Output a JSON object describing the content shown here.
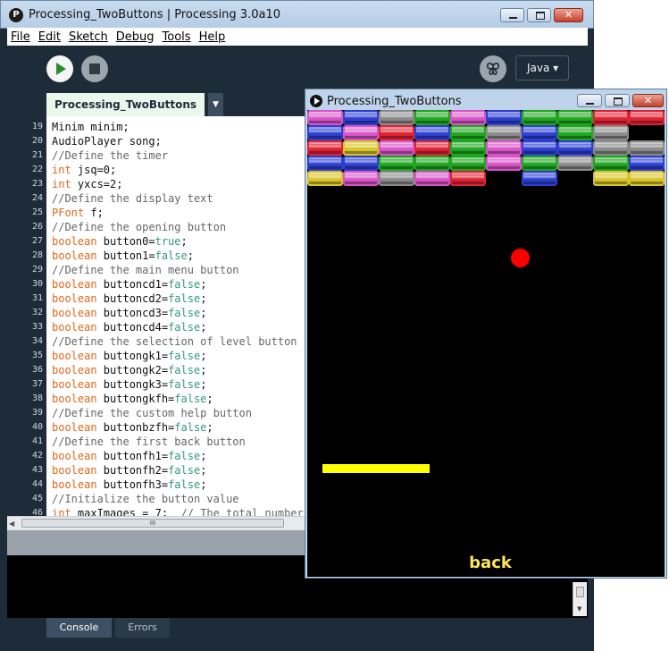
{
  "ide": {
    "title": "Processing_TwoButtons | Processing 3.0a10",
    "logo_glyph": "P",
    "menu": [
      "File",
      "Edit",
      "Sketch",
      "Debug",
      "Tools",
      "Help"
    ],
    "mode": "Java ▾",
    "tab": "Processing_TwoButtons",
    "tab_menu_glyph": "▼",
    "code": [
      {
        "n": "19",
        "parts": [
          {
            "t": "Minim minim;",
            "c": ""
          }
        ]
      },
      {
        "n": "20",
        "parts": [
          {
            "t": "AudioPlayer song;",
            "c": ""
          }
        ]
      },
      {
        "n": "21",
        "parts": [
          {
            "t": "//Define the timer",
            "c": "cm"
          }
        ]
      },
      {
        "n": "22",
        "parts": [
          {
            "t": "int",
            "c": "kw"
          },
          {
            "t": " jsq=0;",
            "c": ""
          }
        ]
      },
      {
        "n": "23",
        "parts": [
          {
            "t": "int",
            "c": "kw"
          },
          {
            "t": " yxcs=2;",
            "c": ""
          }
        ]
      },
      {
        "n": "24",
        "parts": [
          {
            "t": "//Define the display text",
            "c": "cm"
          }
        ]
      },
      {
        "n": "25",
        "parts": [
          {
            "t": "PFont",
            "c": "kw"
          },
          {
            "t": " f;",
            "c": ""
          }
        ]
      },
      {
        "n": "26",
        "parts": [
          {
            "t": "//Define the opening button",
            "c": "cm"
          }
        ]
      },
      {
        "n": "27",
        "parts": [
          {
            "t": "boolean",
            "c": "kw"
          },
          {
            "t": " button0=",
            "c": ""
          },
          {
            "t": "true",
            "c": "lit"
          },
          {
            "t": ";",
            "c": ""
          }
        ]
      },
      {
        "n": "28",
        "parts": [
          {
            "t": "boolean",
            "c": "kw"
          },
          {
            "t": " button1=",
            "c": ""
          },
          {
            "t": "false",
            "c": "lit"
          },
          {
            "t": ";",
            "c": ""
          }
        ]
      },
      {
        "n": "29",
        "parts": [
          {
            "t": "//Define the main menu button",
            "c": "cm"
          }
        ]
      },
      {
        "n": "30",
        "parts": [
          {
            "t": "boolean",
            "c": "kw"
          },
          {
            "t": " buttoncd1=",
            "c": ""
          },
          {
            "t": "false",
            "c": "lit"
          },
          {
            "t": ";",
            "c": ""
          }
        ]
      },
      {
        "n": "31",
        "parts": [
          {
            "t": "boolean",
            "c": "kw"
          },
          {
            "t": " buttoncd2=",
            "c": ""
          },
          {
            "t": "false",
            "c": "lit"
          },
          {
            "t": ";",
            "c": ""
          }
        ]
      },
      {
        "n": "32",
        "parts": [
          {
            "t": "boolean",
            "c": "kw"
          },
          {
            "t": " buttoncd3=",
            "c": ""
          },
          {
            "t": "false",
            "c": "lit"
          },
          {
            "t": ";",
            "c": ""
          }
        ]
      },
      {
        "n": "33",
        "parts": [
          {
            "t": "boolean",
            "c": "kw"
          },
          {
            "t": " buttoncd4=",
            "c": ""
          },
          {
            "t": "false",
            "c": "lit"
          },
          {
            "t": ";",
            "c": ""
          }
        ]
      },
      {
        "n": "34",
        "parts": [
          {
            "t": "//Define the selection of level button",
            "c": "cm"
          }
        ]
      },
      {
        "n": "35",
        "parts": [
          {
            "t": "boolean",
            "c": "kw"
          },
          {
            "t": " buttongk1=",
            "c": ""
          },
          {
            "t": "false",
            "c": "lit"
          },
          {
            "t": ";",
            "c": ""
          }
        ]
      },
      {
        "n": "36",
        "parts": [
          {
            "t": "boolean",
            "c": "kw"
          },
          {
            "t": " buttongk2=",
            "c": ""
          },
          {
            "t": "false",
            "c": "lit"
          },
          {
            "t": ";",
            "c": ""
          }
        ]
      },
      {
        "n": "37",
        "parts": [
          {
            "t": "boolean",
            "c": "kw"
          },
          {
            "t": " buttongk3=",
            "c": ""
          },
          {
            "t": "false",
            "c": "lit"
          },
          {
            "t": ";",
            "c": ""
          }
        ]
      },
      {
        "n": "38",
        "parts": [
          {
            "t": "boolean",
            "c": "kw"
          },
          {
            "t": " buttongkfh=",
            "c": ""
          },
          {
            "t": "false",
            "c": "lit"
          },
          {
            "t": ";",
            "c": ""
          }
        ]
      },
      {
        "n": "39",
        "parts": [
          {
            "t": "//Define the custom help button",
            "c": "cm"
          }
        ]
      },
      {
        "n": "40",
        "parts": [
          {
            "t": "boolean",
            "c": "kw"
          },
          {
            "t": " buttonbzfh=",
            "c": ""
          },
          {
            "t": "false",
            "c": "lit"
          },
          {
            "t": ";",
            "c": ""
          }
        ]
      },
      {
        "n": "41",
        "parts": [
          {
            "t": "//Define the first back button",
            "c": "cm"
          }
        ]
      },
      {
        "n": "42",
        "parts": [
          {
            "t": "boolean",
            "c": "kw"
          },
          {
            "t": " buttonfh1=",
            "c": ""
          },
          {
            "t": "false",
            "c": "lit"
          },
          {
            "t": ";",
            "c": ""
          }
        ]
      },
      {
        "n": "43",
        "parts": [
          {
            "t": "boolean",
            "c": "kw"
          },
          {
            "t": " buttonfh2=",
            "c": ""
          },
          {
            "t": "false",
            "c": "lit"
          },
          {
            "t": ";",
            "c": ""
          }
        ]
      },
      {
        "n": "44",
        "parts": [
          {
            "t": "boolean",
            "c": "kw"
          },
          {
            "t": " buttonfh3=",
            "c": ""
          },
          {
            "t": "false",
            "c": "lit"
          },
          {
            "t": ";",
            "c": ""
          }
        ]
      },
      {
        "n": "45",
        "parts": [
          {
            "t": "//Initialize the button value",
            "c": "cm"
          }
        ]
      },
      {
        "n": "46",
        "parts": [
          {
            "t": "int",
            "c": "kw"
          },
          {
            "t": " maxImages = 7;  ",
            "c": ""
          },
          {
            "t": "// The total number",
            "c": "cm"
          }
        ]
      }
    ],
    "console_tabs": [
      "Console",
      "Errors"
    ],
    "scroll_grip": "III"
  },
  "sketch": {
    "title": "Processing_TwoButtons",
    "back_label": "back",
    "brick_colors": {
      "magenta": "#d754c8",
      "blue": "#2c3fd0",
      "gray": "#8a8a8a",
      "green": "#1fa51f",
      "red": "#dd2233",
      "yellow": "#d8c42a"
    },
    "brick_rows": [
      [
        "magenta",
        "blue",
        "gray",
        "green",
        "magenta",
        "blue",
        "green",
        "green",
        "red",
        "red"
      ],
      [
        "blue",
        "magenta",
        "red",
        "blue",
        "green",
        "gray",
        "blue",
        "green",
        "gray",
        null
      ],
      [
        "red",
        "yellow",
        "magenta",
        "red",
        "green",
        "magenta",
        "blue",
        "blue",
        "gray",
        "gray"
      ],
      [
        "blue",
        "blue",
        "green",
        "green",
        "green",
        "magenta",
        "green",
        "gray",
        "green",
        "blue"
      ],
      [
        "yellow",
        "magenta",
        "gray",
        "magenta",
        "red",
        null,
        "blue",
        null,
        "yellow",
        "yellow"
      ]
    ],
    "ball_color": "#ff0000",
    "paddle_color": "#ffff00"
  }
}
